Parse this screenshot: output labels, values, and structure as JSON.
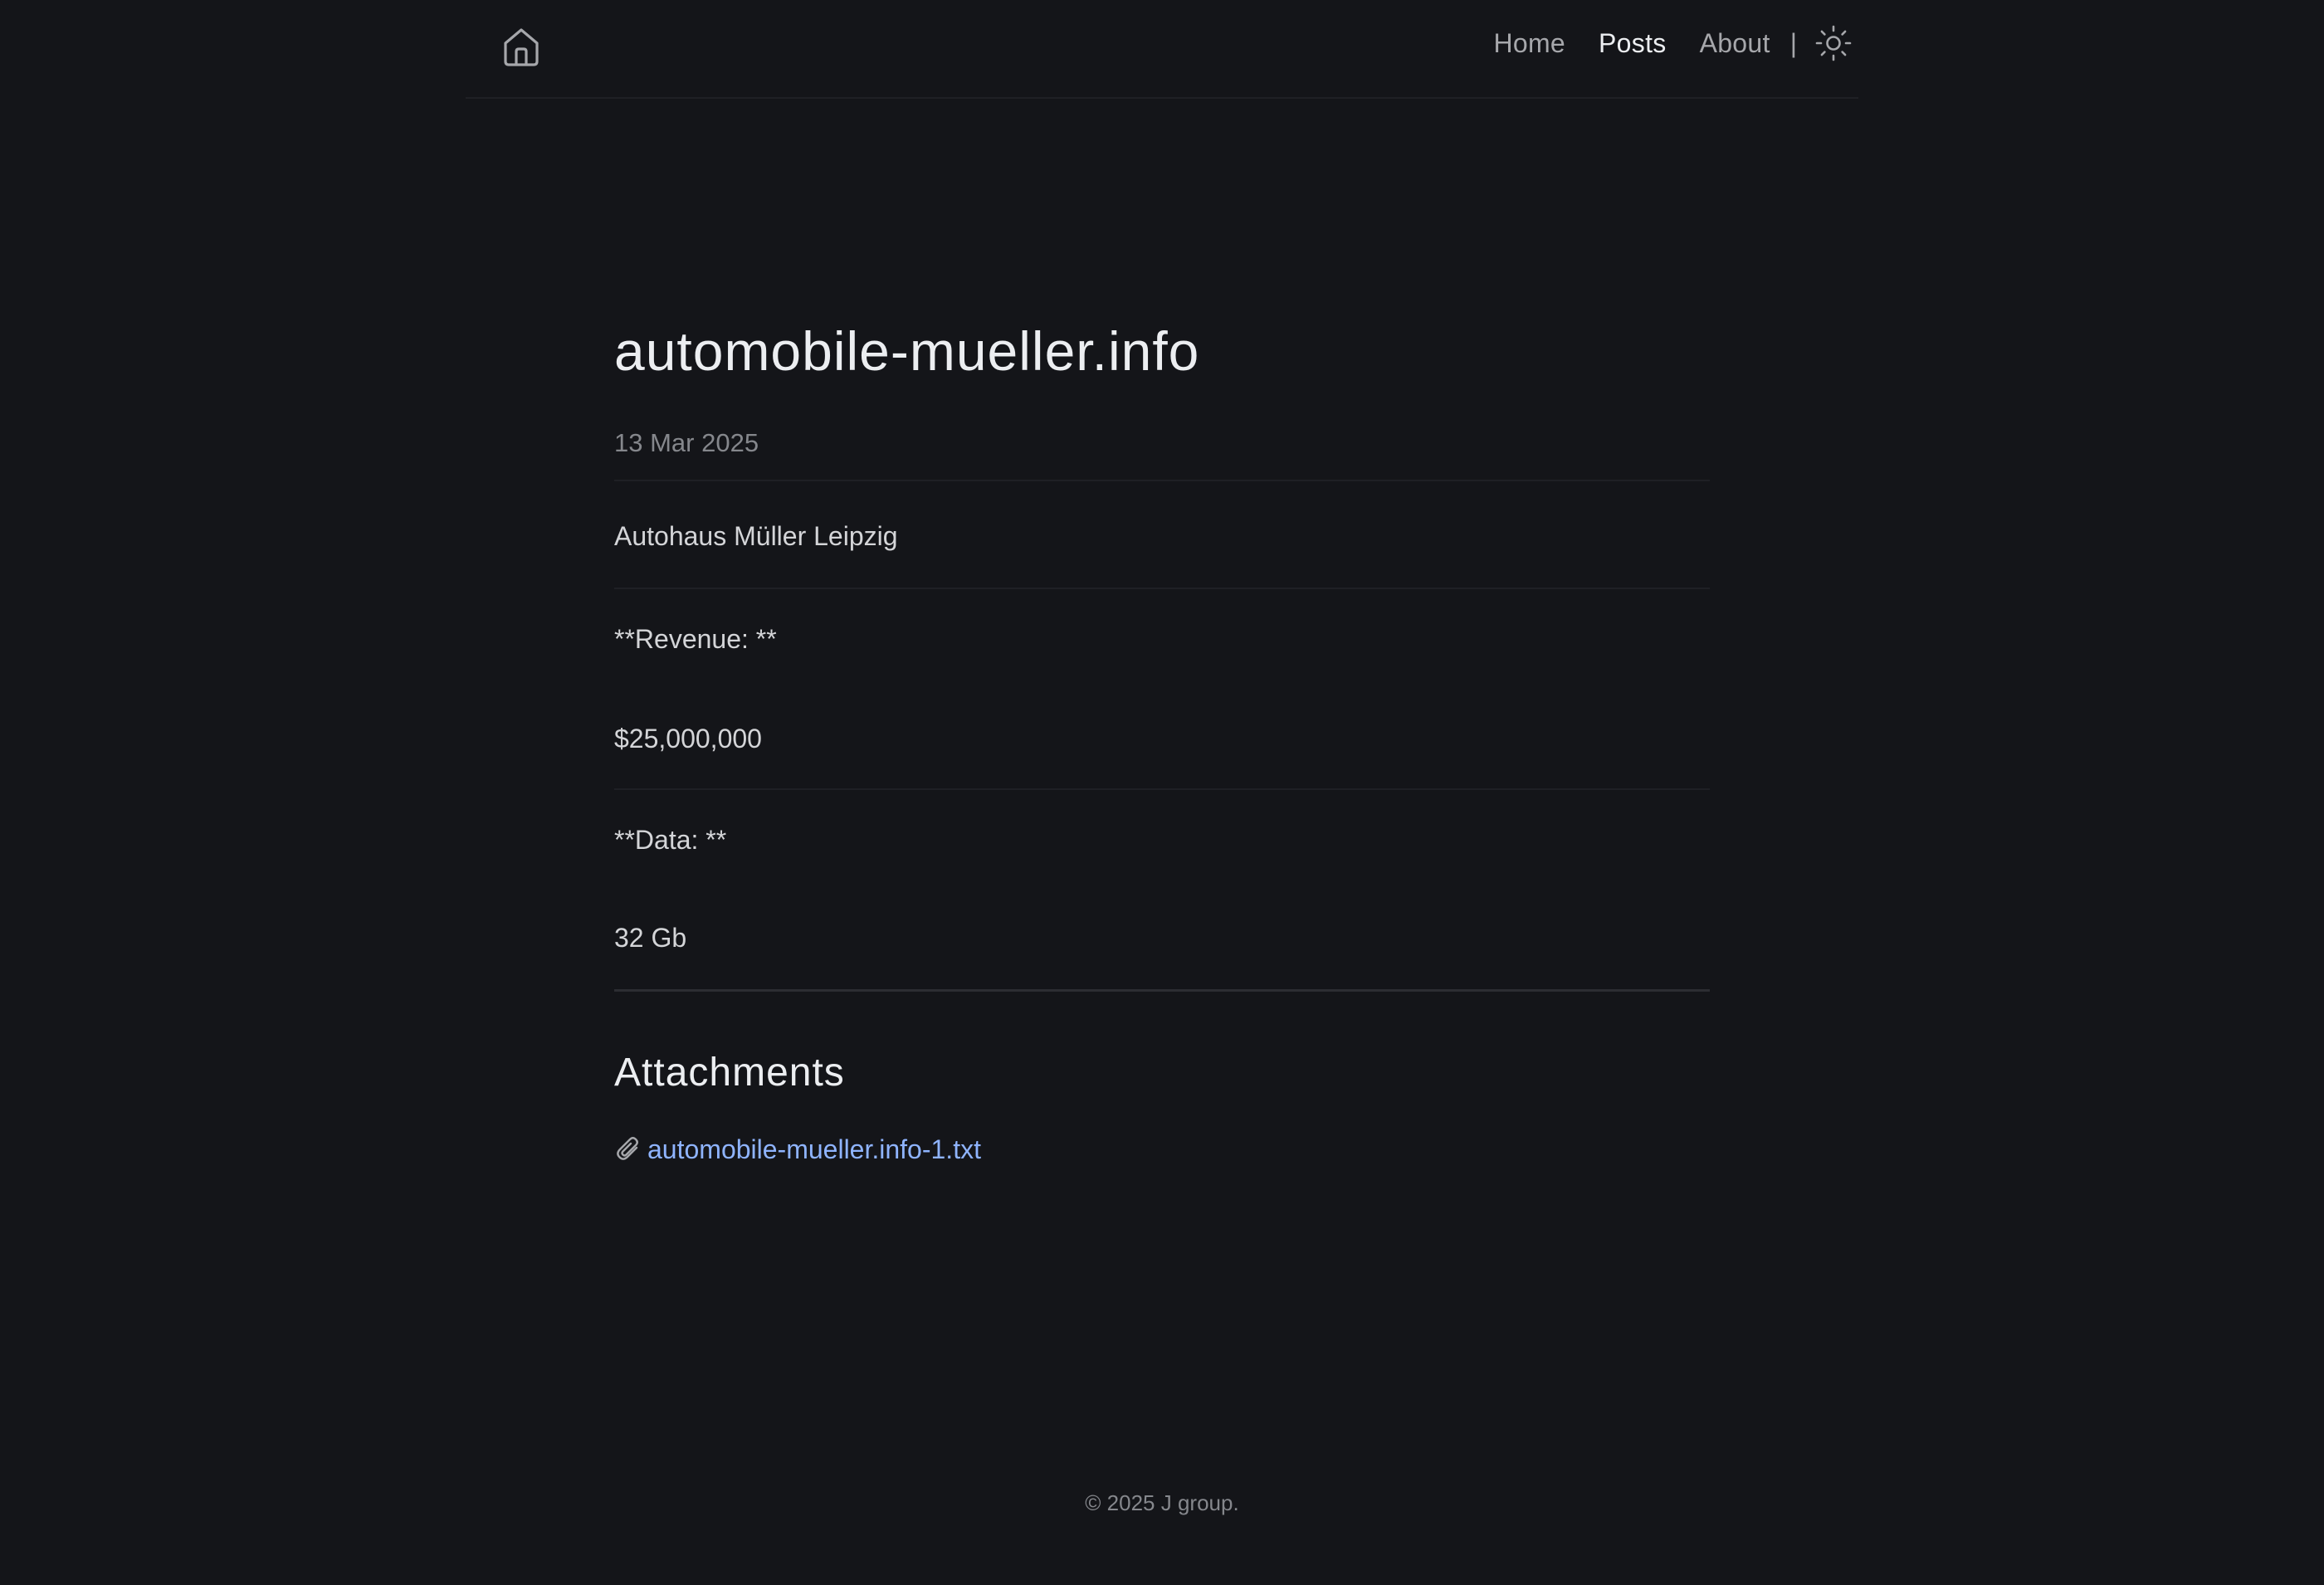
{
  "header": {
    "nav": [
      {
        "label": "Home",
        "active": false
      },
      {
        "label": "Posts",
        "active": true
      },
      {
        "label": "About",
        "active": false
      }
    ],
    "separator": "|",
    "home_icon": "home-icon",
    "theme_icon": "sun-icon"
  },
  "post": {
    "title": "automobile-mueller.info",
    "date": "13 Mar 2025",
    "company": "Autohaus Müller Leipzig",
    "revenue_label": "**Revenue: **",
    "revenue_value": "$25,000,000",
    "data_label": "**Data: **",
    "data_value": "32 Gb"
  },
  "attachments": {
    "heading": "Attachments",
    "icon": "paperclip-icon",
    "files": [
      {
        "name": "automobile-mueller.info-1.txt"
      }
    ]
  },
  "footer": {
    "text": "© 2025 J group."
  },
  "colors": {
    "background": "#141519",
    "text": "#d4d5d8",
    "muted": "#85878c",
    "link": "#8fb4ff"
  }
}
